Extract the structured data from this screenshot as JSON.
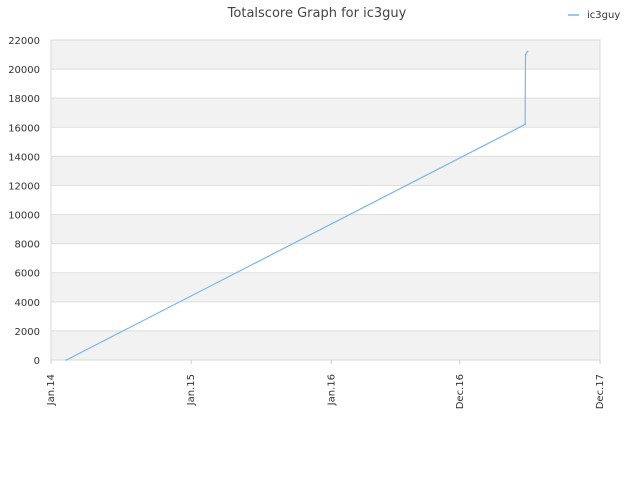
{
  "chart_data": {
    "type": "line",
    "title": "Totalscore Graph for ic3guy",
    "xlabel": "",
    "ylabel": "",
    "x_ticks": [
      "Jan.14",
      "Jan.15",
      "Jan.16",
      "Dec.16",
      "Dec.17"
    ],
    "x_tick_dates": [
      "2014-01-01",
      "2015-01-01",
      "2016-01-01",
      "2016-12-01",
      "2017-12-01"
    ],
    "xlim": [
      "2014-01-01",
      "2017-12-01"
    ],
    "y_ticks": [
      0,
      2000,
      4000,
      6000,
      8000,
      10000,
      12000,
      14000,
      16000,
      18000,
      20000,
      22000
    ],
    "ylim": [
      0,
      22000
    ],
    "grid": true,
    "legend_position": "top-right",
    "series": [
      {
        "name": "ic3guy",
        "color": "#7cb5ec",
        "points": [
          {
            "x": "2014-02-10",
            "y": 0
          },
          {
            "x": "2017-05-20",
            "y": 16200
          },
          {
            "x": "2017-05-21",
            "y": 21000
          },
          {
            "x": "2017-05-26",
            "y": 21200
          }
        ]
      }
    ]
  }
}
